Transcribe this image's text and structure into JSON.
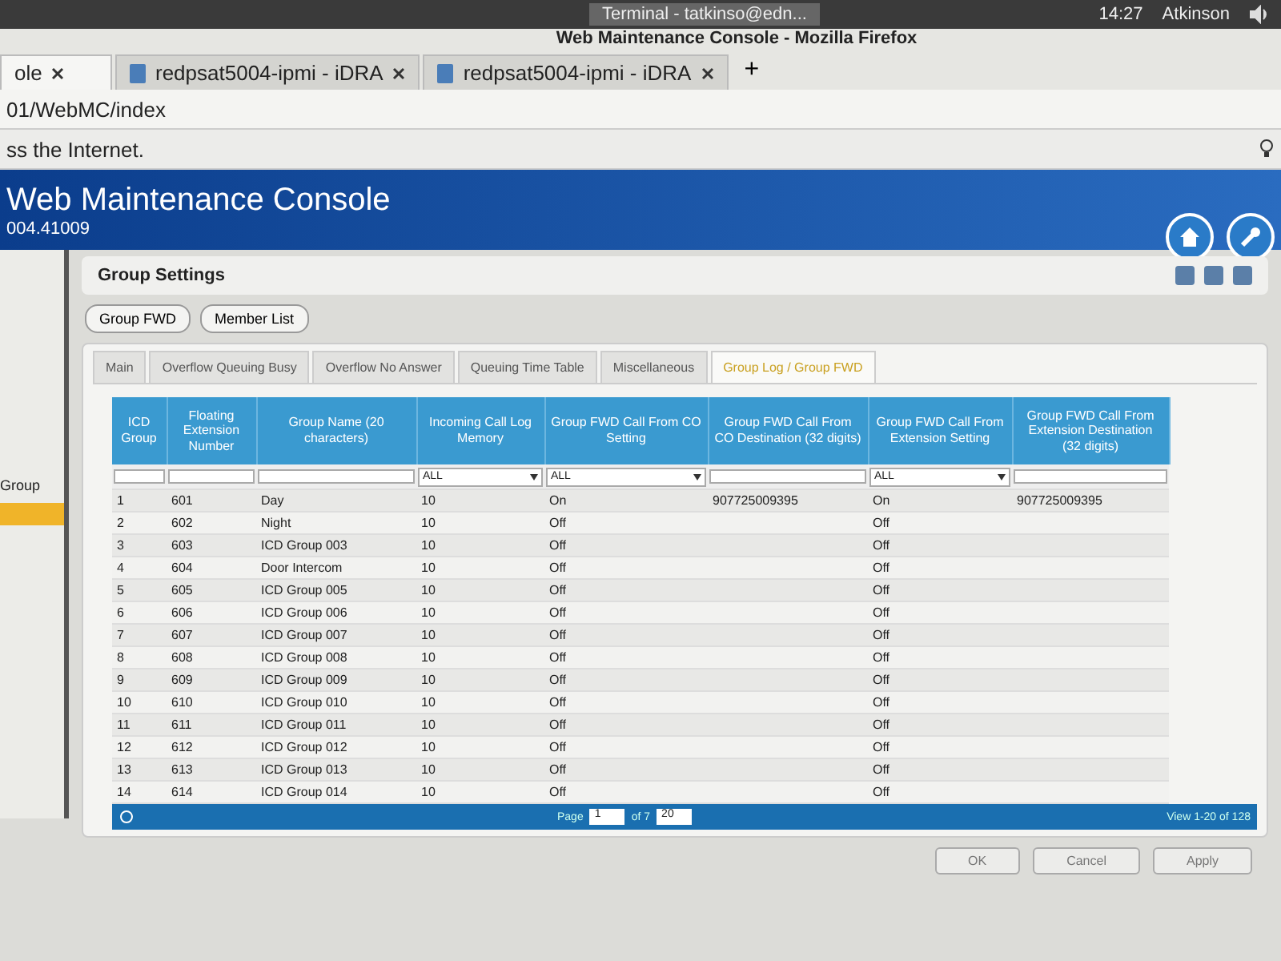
{
  "system_bar": {
    "task": "Terminal - tatkinso@edn...",
    "time": "14:27",
    "user": "Atkinson"
  },
  "window": {
    "title": "Web Maintenance Console - Mozilla Firefox"
  },
  "browser_tabs": [
    {
      "label": "ole",
      "selected": true
    },
    {
      "label": "redpsat5004-ipmi - iDRA",
      "selected": false
    },
    {
      "label": "redpsat5004-ipmi - iDRA",
      "selected": false
    }
  ],
  "new_tab": "+",
  "address": "01/WebMC/index",
  "notice": "ss the Internet.",
  "banner": {
    "title": "Web Maintenance Console",
    "version": "004.41009"
  },
  "sidebar": {
    "items": [
      {
        "label": "Group",
        "selected": false
      },
      {
        "selected": true
      }
    ]
  },
  "panel": {
    "title": "Group Settings",
    "buttons": [
      "Group FWD",
      "Member List"
    ],
    "tabs": [
      {
        "label": "Main",
        "selected": false
      },
      {
        "label": "Overflow Queuing Busy",
        "selected": false
      },
      {
        "label": "Overflow No Answer",
        "selected": false
      },
      {
        "label": "Queuing Time Table",
        "selected": false
      },
      {
        "label": "Miscellaneous",
        "selected": false
      },
      {
        "label": "Group Log / Group FWD",
        "selected": true
      }
    ],
    "table": {
      "columns": [
        "ICD Group",
        "Floating Extension Number",
        "Group Name (20 characters)",
        "Incoming Call Log Memory",
        "Group FWD Call From CO Setting",
        "Group FWD Call From CO Destination (32 digits)",
        "Group FWD Call From Extension Setting",
        "Group FWD Call From Extension Destination (32 digits)"
      ],
      "filters": [
        {
          "kind": "text"
        },
        {
          "kind": "text"
        },
        {
          "kind": "text"
        },
        {
          "kind": "select",
          "value": "ALL"
        },
        {
          "kind": "select",
          "value": "ALL"
        },
        {
          "kind": "text"
        },
        {
          "kind": "select",
          "value": "ALL"
        },
        {
          "kind": "text"
        }
      ],
      "rows": [
        [
          "1",
          "601",
          "Day",
          "10",
          "On",
          "907725009395",
          "On",
          "907725009395"
        ],
        [
          "2",
          "602",
          "Night",
          "10",
          "Off",
          "",
          "Off",
          ""
        ],
        [
          "3",
          "603",
          "ICD Group 003",
          "10",
          "Off",
          "",
          "Off",
          ""
        ],
        [
          "4",
          "604",
          "Door Intercom",
          "10",
          "Off",
          "",
          "Off",
          ""
        ],
        [
          "5",
          "605",
          "ICD Group 005",
          "10",
          "Off",
          "",
          "Off",
          ""
        ],
        [
          "6",
          "606",
          "ICD Group 006",
          "10",
          "Off",
          "",
          "Off",
          ""
        ],
        [
          "7",
          "607",
          "ICD Group 007",
          "10",
          "Off",
          "",
          "Off",
          ""
        ],
        [
          "8",
          "608",
          "ICD Group 008",
          "10",
          "Off",
          "",
          "Off",
          ""
        ],
        [
          "9",
          "609",
          "ICD Group 009",
          "10",
          "Off",
          "",
          "Off",
          ""
        ],
        [
          "10",
          "610",
          "ICD Group 010",
          "10",
          "Off",
          "",
          "Off",
          ""
        ],
        [
          "11",
          "611",
          "ICD Group 011",
          "10",
          "Off",
          "",
          "Off",
          ""
        ],
        [
          "12",
          "612",
          "ICD Group 012",
          "10",
          "Off",
          "",
          "Off",
          ""
        ],
        [
          "13",
          "613",
          "ICD Group 013",
          "10",
          "Off",
          "",
          "Off",
          ""
        ],
        [
          "14",
          "614",
          "ICD Group 014",
          "10",
          "Off",
          "",
          "Off",
          ""
        ]
      ]
    },
    "pager": {
      "label": "Page",
      "page": "1",
      "of": "of 7",
      "page_size": "20",
      "summary": "View 1-20 of 128"
    },
    "actions": [
      "OK",
      "Cancel",
      "Apply"
    ]
  }
}
